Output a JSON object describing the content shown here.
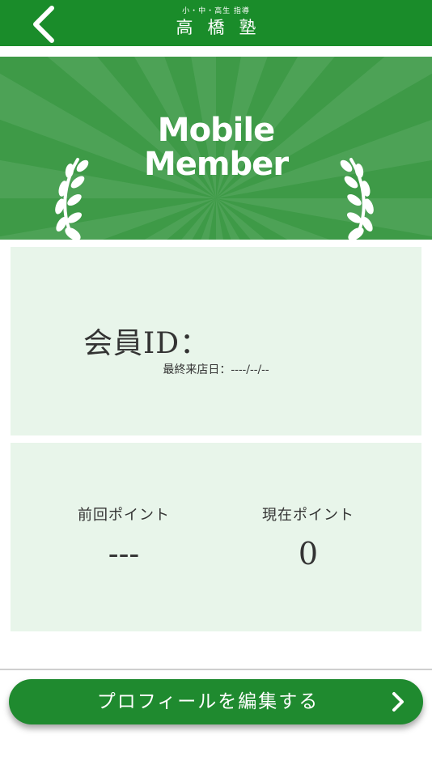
{
  "header": {
    "back_icon": "chevron-left-icon",
    "logo_subtitle": "小・中・高生 指導",
    "logo_title": "高橋塾"
  },
  "banner": {
    "title_line1": "Mobile",
    "title_line2": "Member",
    "icons": [
      "laurel-left-icon",
      "laurel-right-icon"
    ],
    "colors": {
      "background": "#3e9a47",
      "rays": "#5aaa62"
    }
  },
  "member_card": {
    "id_label": "会員ID：",
    "last_visit": "最終来店日：----/--/--"
  },
  "points": {
    "previous_label": "前回ポイント",
    "previous_value": "---",
    "current_label": "現在ポイント",
    "current_value": "0"
  },
  "footer": {
    "edit_profile_label": "プロフィールを編集する",
    "chevron_icon": "chevron-right-icon"
  },
  "colors": {
    "header": "#1a8c2a",
    "card_background": "#e8f5ea",
    "button": "#1f8a2f"
  }
}
